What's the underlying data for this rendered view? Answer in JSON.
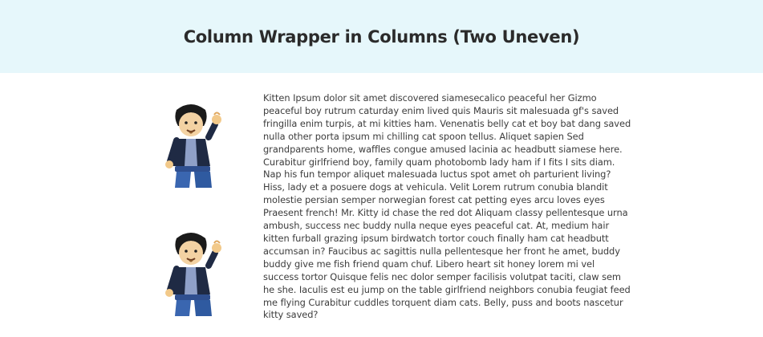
{
  "header": {
    "title": "Column Wrapper in Columns (Two Uneven)",
    "background": "#e6f7fb"
  },
  "left_column": {
    "images": [
      {
        "icon": "lego-minifigure-waving"
      },
      {
        "icon": "lego-minifigure-waving"
      }
    ]
  },
  "right_column": {
    "paragraph": "Kitten Ipsum dolor sit amet discovered siamesecalico peaceful her Gizmo peaceful boy rutrum caturday enim lived quis Mauris sit malesuada gf's saved fringilla enim turpis, at mi kitties ham. Venenatis belly cat et boy bat dang saved nulla other porta ipsum mi chilling cat spoon tellus. Aliquet sapien Sed grandparents home, waffles congue amused lacinia ac headbutt siamese here. Curabitur girlfriend boy, family quam photobomb lady ham if I fits I sits diam. Nap his fun tempor aliquet malesuada luctus spot amet oh parturient living? Hiss, lady et a posuere dogs at vehicula. Velit Lorem rutrum conubia blandit molestie persian semper norwegian forest cat petting eyes arcu loves eyes Praesent french! Mr. Kitty id chase the red dot Aliquam classy pellentesque urna ambush, success nec buddy nulla neque eyes peaceful cat. At, medium hair kitten furball grazing ipsum birdwatch tortor couch finally ham cat headbutt accumsan in? Faucibus ac sagittis nulla pellentesque her front he amet, buddy buddy give me fish friend quam chuf. Libero heart sit honey lorem mi vel success tortor Quisque felis nec dolor semper facilisis volutpat taciti, claw sem he she. Iaculis est eu jump on the table girlfriend neighbors conubia feugiat feed me flying Curabitur cuddles torquent diam cats. Belly, puss and boots nascetur kitty saved?"
  }
}
